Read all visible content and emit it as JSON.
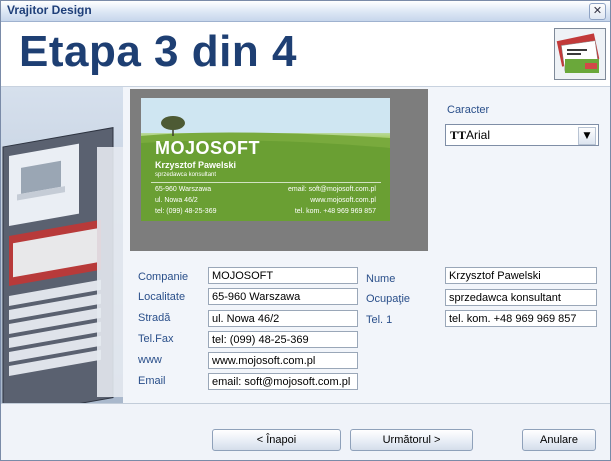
{
  "window": {
    "title": "Vrajitor Design",
    "close_label": "✕"
  },
  "header": {
    "title": "Etapa 3 din 4"
  },
  "font": {
    "label": "Caracter",
    "value": "Arial",
    "arrow": "▼",
    "icon": "TT"
  },
  "card": {
    "company": "MOJOSOFT",
    "name": "Krzysztof Pawelski",
    "job": "sprzedawca konsultant",
    "left_lines": [
      "65-960 Warszawa",
      "ul. Nowa 46/2",
      "tel: (099) 48-25-369"
    ],
    "right_lines": [
      "email: soft@mojosoft.com.pl",
      "www.mojosoft.com.pl",
      "tel. kom. +48 969 969 857"
    ]
  },
  "form": {
    "left": [
      {
        "label": "Companie",
        "value": "MOJOSOFT"
      },
      {
        "label": "Localitate",
        "value": "65-960 Warszawa"
      },
      {
        "label": "Stradă",
        "value": "ul. Nowa 46/2"
      },
      {
        "label": "Tel.Fax",
        "value": "tel: (099) 48-25-369"
      },
      {
        "label": "www",
        "value": "www.mojosoft.com.pl"
      },
      {
        "label": "Email",
        "value": "email: soft@mojosoft.com.pl"
      }
    ],
    "right": [
      {
        "label": "Nume",
        "value": "Krzysztof Pawelski"
      },
      {
        "label": "Ocupaţie",
        "value": "sprzedawca konsultant"
      },
      {
        "label": "Tel. 1",
        "value": "tel. kom. +48 969 969 857"
      }
    ]
  },
  "buttons": {
    "back": "< Înapoi",
    "next": "Următorul >",
    "cancel": "Anulare"
  },
  "colors": {
    "label_blue": "#2a4f8a",
    "title_blue": "#1e3f73"
  }
}
